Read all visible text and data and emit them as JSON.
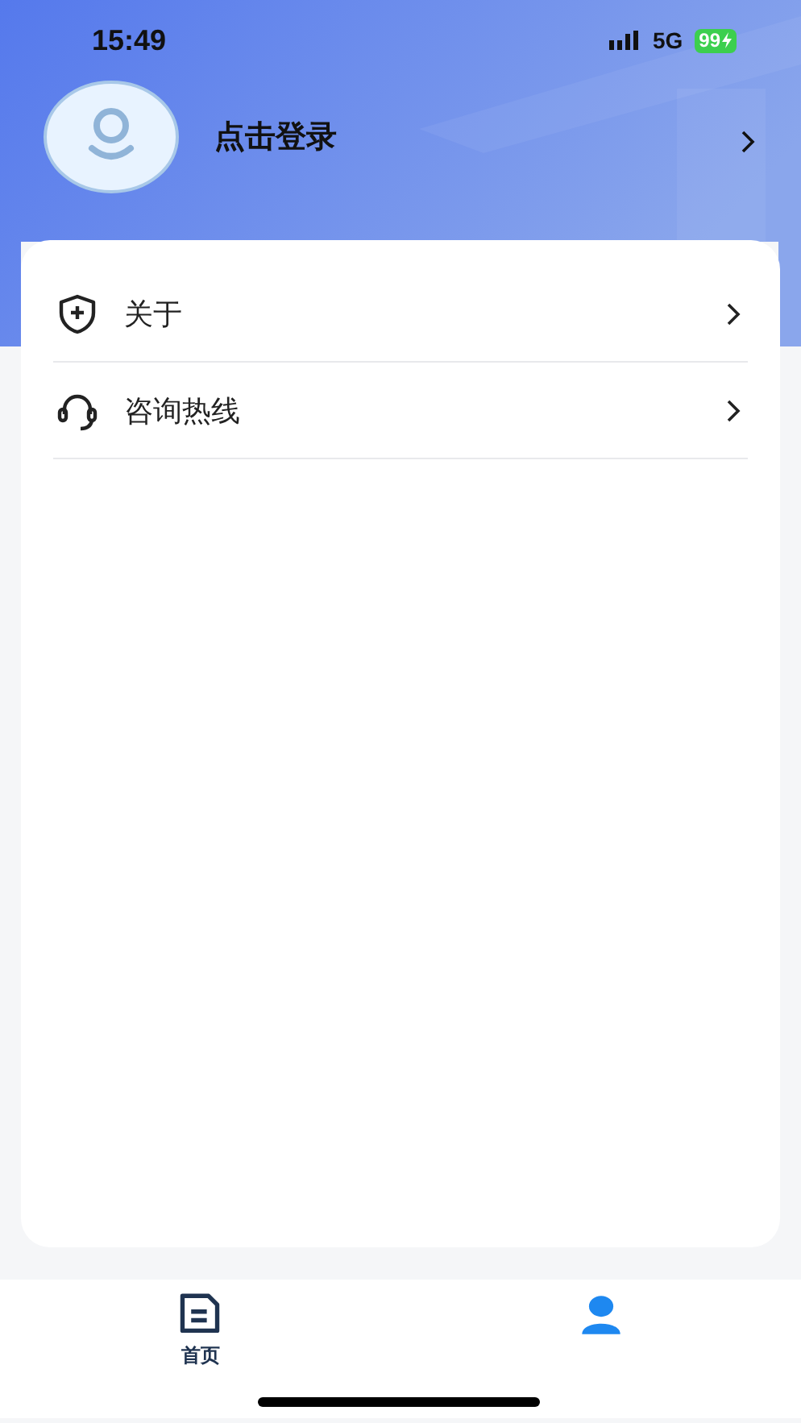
{
  "status_bar": {
    "time": "15:49",
    "network": "5G",
    "battery": "99"
  },
  "profile": {
    "login_label": "点击登录"
  },
  "menu": [
    {
      "label": "关于"
    },
    {
      "label": "咨询热线"
    }
  ],
  "tab_bar": [
    {
      "label": "首页",
      "selected": false
    },
    {
      "selected": true
    }
  ]
}
